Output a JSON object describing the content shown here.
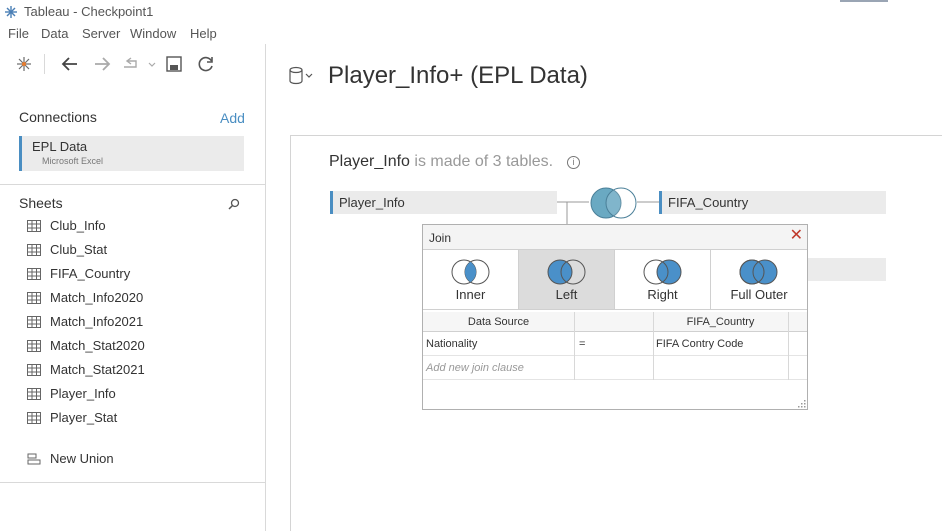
{
  "window": {
    "title": "Tableau - Checkpoint1"
  },
  "menu": [
    "File",
    "Data",
    "Server",
    "Window",
    "Help"
  ],
  "connections": {
    "header": "Connections",
    "add_label": "Add",
    "items": [
      {
        "name": "EPL Data",
        "type": "Microsoft Excel"
      }
    ]
  },
  "sheets": {
    "header": "Sheets",
    "items": [
      "Club_Info",
      "Club_Stat",
      "FIFA_Country",
      "Match_Info2020",
      "Match_Info2021",
      "Match_Stat2020",
      "Match_Stat2021",
      "Player_Info",
      "Player_Stat"
    ],
    "new_union": "New Union"
  },
  "datasource": {
    "title": "Player_Info+ (EPL Data)"
  },
  "canvas": {
    "table_name": "Player_Info",
    "made_of_text": " is made of 3 tables.",
    "info_icon": "i",
    "left_table": "Player_Info",
    "right_table": "FIFA_Country"
  },
  "join_dialog": {
    "title": "Join",
    "close": "✕",
    "types": [
      {
        "label": "Inner",
        "selected": false
      },
      {
        "label": "Left",
        "selected": true
      },
      {
        "label": "Right",
        "selected": false
      },
      {
        "label": "Full Outer",
        "selected": false
      }
    ],
    "columns": {
      "left": "Data Source",
      "right": "FIFA_Country"
    },
    "clauses": [
      {
        "left": "Nationality",
        "op": "=",
        "right": "FIFA Contry Code"
      }
    ],
    "add_placeholder": "Add new join clause"
  },
  "colors": {
    "accent": "#4a8ec2",
    "venn_fill": "#4a90c9",
    "venn_teal": "#6aa9c2",
    "selected_bg": "#dcdcdc"
  }
}
